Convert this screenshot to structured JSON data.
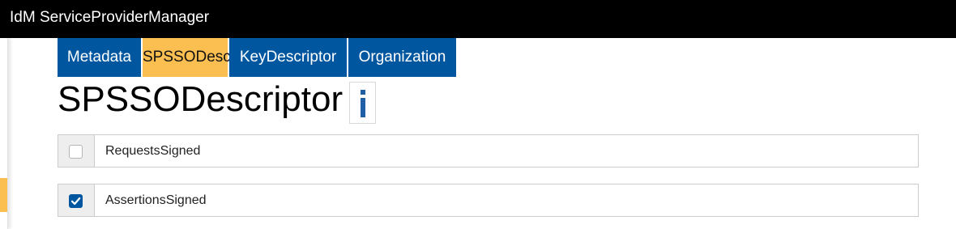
{
  "app": {
    "title": "IdM ServiceProviderManager"
  },
  "colors": {
    "tab_blue": "#0057A0",
    "tab_active": "#FBBE50",
    "check_blue": "#0057A0",
    "info_blue": "#1E5FA8"
  },
  "tabs": [
    {
      "label": "Metadata",
      "active": false
    },
    {
      "label": "SPSSODescriptor",
      "active": true
    },
    {
      "label": "KeyDescriptor",
      "active": false
    },
    {
      "label": "Organization",
      "active": false
    }
  ],
  "page": {
    "heading": "SPSSODescriptor",
    "info_icon": "info-icon"
  },
  "fields": [
    {
      "label": "RequestsSigned",
      "checked": false
    },
    {
      "label": "AssertionsSigned",
      "checked": true
    }
  ]
}
